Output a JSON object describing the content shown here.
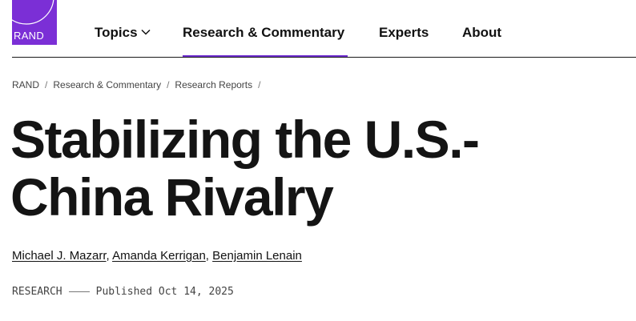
{
  "brand": {
    "logo_text": "RAND",
    "color": "#7b2fd6"
  },
  "nav": {
    "items": [
      {
        "label": "Topics",
        "has_dropdown": true
      },
      {
        "label": "Research & Commentary",
        "active": true
      },
      {
        "label": "Experts"
      },
      {
        "label": "About"
      }
    ],
    "active_color": "#6f2ed0"
  },
  "breadcrumb": {
    "items": [
      "RAND",
      "Research & Commentary",
      "Research Reports"
    ],
    "separator": "/"
  },
  "article": {
    "title_line1": "Stabilizing the U.S.-",
    "title_line2": "China Rivalry",
    "authors": [
      "Michael J. Mazarr",
      "Amanda Kerrigan",
      "Benjamin Lenain"
    ],
    "author_separator": ", ",
    "category": "RESEARCH",
    "published": "Published Oct 14, 2025"
  }
}
